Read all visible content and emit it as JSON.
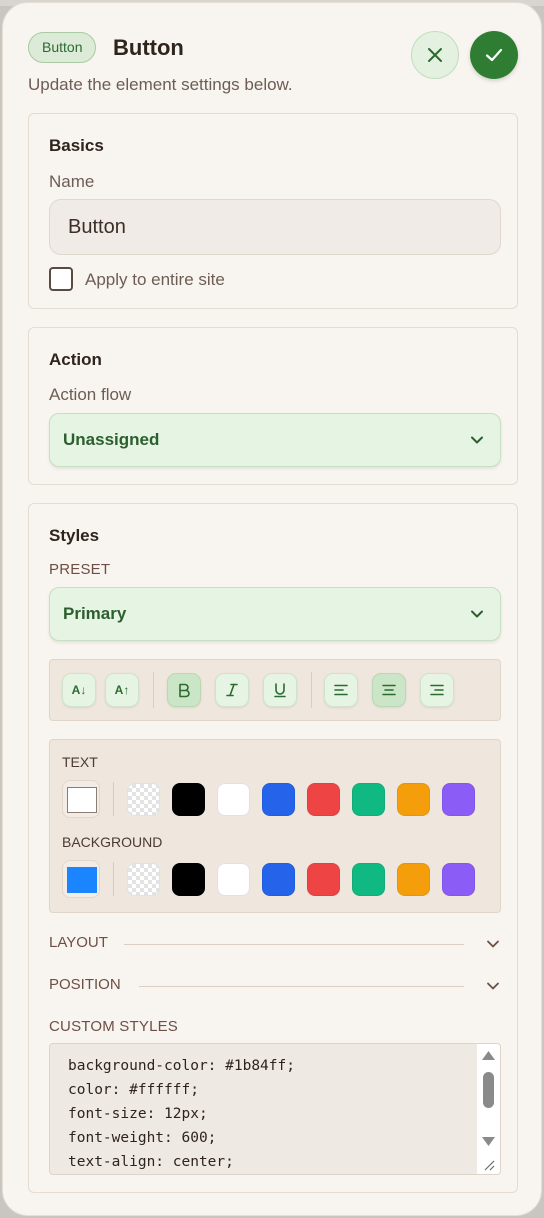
{
  "header": {
    "chip_label": "Button",
    "title": "Button",
    "subtitle": "Update the element settings below.",
    "close_icon": "close-icon",
    "confirm_icon": "check-icon"
  },
  "basics": {
    "section_title": "Basics",
    "name_label": "Name",
    "name_value": "Button",
    "apply_label": "Apply to entire site",
    "apply_checked": false
  },
  "action": {
    "section_title": "Action",
    "flow_label": "Action flow",
    "flow_value": "Unassigned"
  },
  "styles": {
    "section_title": "Styles",
    "preset_label": "PRESET",
    "preset_value": "Primary",
    "toolbar": {
      "font_decrease": "A↓",
      "font_increase": "A↑",
      "bold_active": true,
      "align_center_active": true
    },
    "text_label": "TEXT",
    "background_label": "BACKGROUND",
    "text_current_color": "#ffffff",
    "background_current_color": "#1b84ff",
    "palette": [
      "transparent",
      "#000000",
      "#ffffff",
      "#2563eb",
      "#ef4444",
      "#10b981",
      "#f59e0b",
      "#8b5cf6"
    ],
    "layout_label": "LAYOUT",
    "position_label": "POSITION",
    "custom_styles_label": "CUSTOM STYLES",
    "custom_css_lines": [
      "background-color: #1b84ff;",
      "color: #ffffff;",
      "font-size: 12px;",
      "font-weight: 600;",
      "text-align: center;"
    ]
  },
  "colors": {
    "accent_green": "#2e7d32",
    "select_bg": "#e6f4e3"
  }
}
